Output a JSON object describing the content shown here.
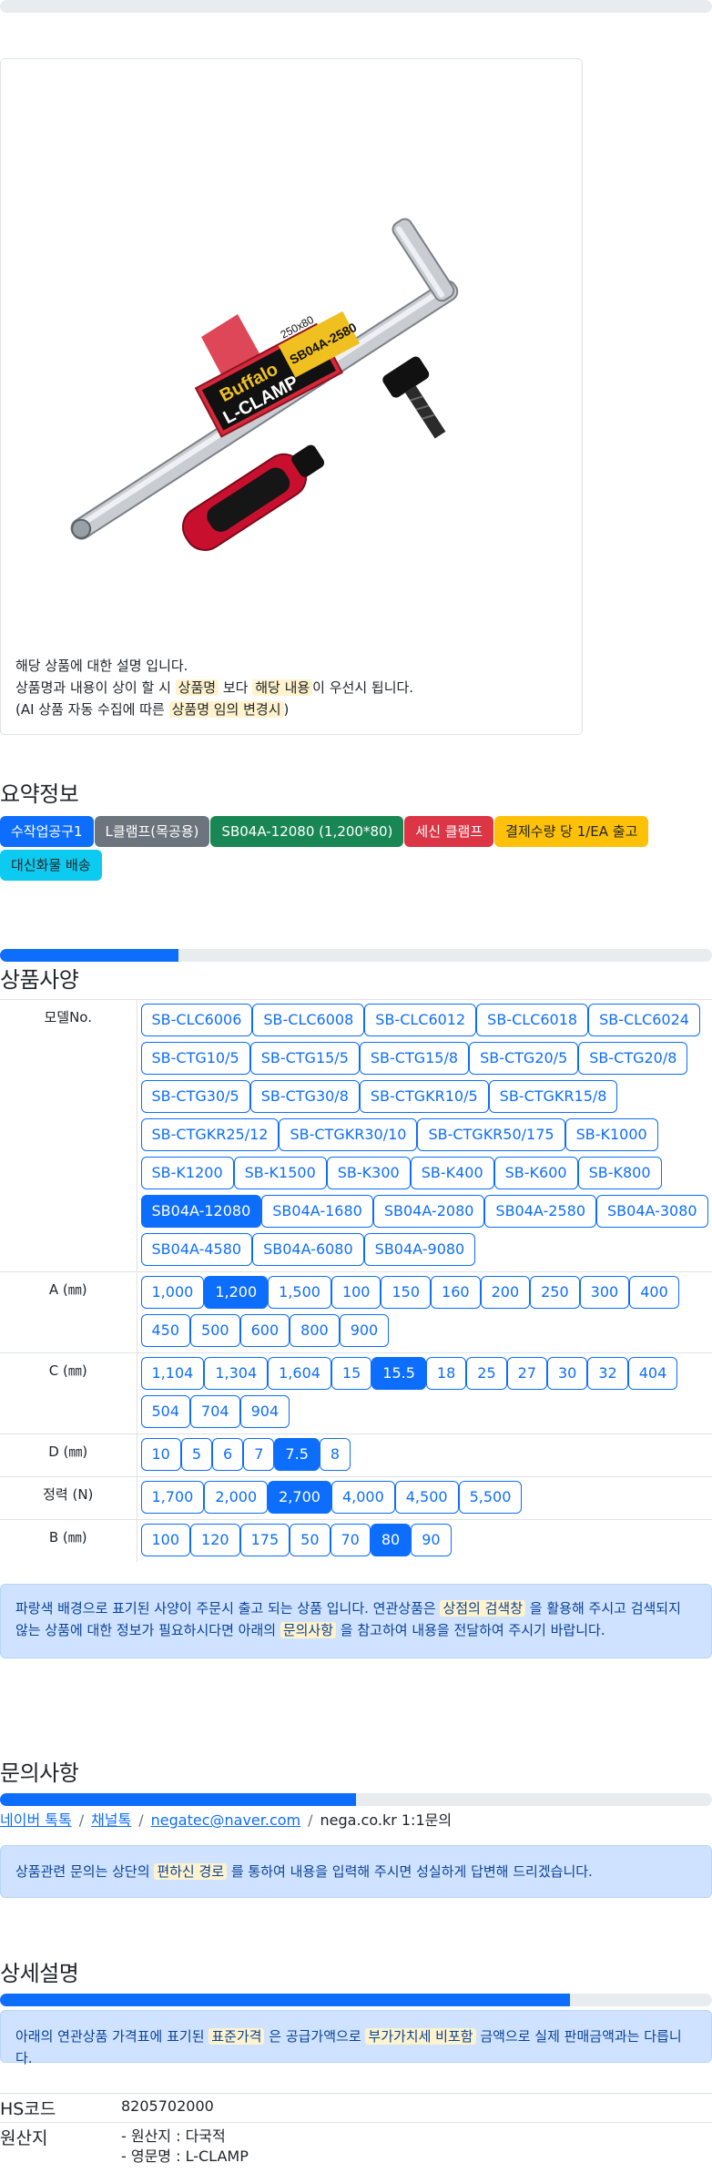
{
  "product_description": {
    "line1": "해당 상품에 대한 설명 입니다.",
    "line2_pre": "상품명과 내용이 상이 할 시 ",
    "line2_hl1": "상품명",
    "line2_mid": " 보다 ",
    "line2_hl2": "해당 내용",
    "line2_post": "이 우선시 됩니다.",
    "line3_pre": "(AI 상품 자동 수집에 따른 ",
    "line3_hl": "상품명 임의 변경시",
    "line3_post": ")"
  },
  "product_image": {
    "brand": "Buffalo",
    "type": "L-CLAMP",
    "model": "SB04A-2580",
    "size": "250x80",
    "icon": "l-clamp-photo"
  },
  "summary": {
    "title": "요약정보",
    "badges": [
      {
        "label": "수작업공구1",
        "color": "#0d6efd",
        "text_color": "#ffffff"
      },
      {
        "label": "L클램프(목공용)",
        "color": "#6c757d",
        "text_color": "#ffffff"
      },
      {
        "label": "SB04A-12080 (1,200*80)",
        "color": "#198754",
        "text_color": "#ffffff"
      },
      {
        "label": "세신 클램프",
        "color": "#dc3545",
        "text_color": "#ffffff"
      },
      {
        "label": "결제수량 당 1/EA 출고",
        "color": "#ffc107",
        "text_color": "#212529"
      },
      {
        "label": "대신화물 배송",
        "color": "#0dcaf0",
        "text_color": "#212529"
      }
    ]
  },
  "spec": {
    "title": "상품사양",
    "progress": 0.25,
    "rows": [
      {
        "label": "모델No.",
        "options": [
          "SB-CLC6006",
          "SB-CLC6008",
          "SB-CLC6012",
          "SB-CLC6018",
          "SB-CLC6024",
          "SB-CTG10/5",
          "SB-CTG15/5",
          "SB-CTG15/8",
          "SB-CTG20/5",
          "SB-CTG20/8",
          "SB-CTG30/5",
          "SB-CTG30/8",
          "SB-CTGKR10/5",
          "SB-CTGKR15/8",
          "SB-CTGKR25/12",
          "SB-CTGKR30/10",
          "SB-CTGKR50/175",
          "SB-K1000",
          "SB-K1200",
          "SB-K1500",
          "SB-K300",
          "SB-K400",
          "SB-K600",
          "SB-K800",
          "SB04A-12080",
          "SB04A-1680",
          "SB04A-2080",
          "SB04A-2580",
          "SB04A-3080",
          "SB04A-4580",
          "SB04A-6080",
          "SB04A-9080"
        ],
        "selected": "SB04A-12080"
      },
      {
        "label": "A (㎜)",
        "options": [
          "1,000",
          "1,200",
          "1,500",
          "100",
          "150",
          "160",
          "200",
          "250",
          "300",
          "400",
          "450",
          "500",
          "600",
          "800",
          "900"
        ],
        "selected": "1,200"
      },
      {
        "label": "C (㎜)",
        "options": [
          "1,104",
          "1,304",
          "1,604",
          "15",
          "15.5",
          "18",
          "25",
          "27",
          "30",
          "32",
          "404",
          "504",
          "704",
          "904"
        ],
        "selected": "15.5"
      },
      {
        "label": "D (㎜)",
        "options": [
          "10",
          "5",
          "6",
          "7",
          "7.5",
          "8"
        ],
        "selected": "7.5"
      },
      {
        "label": "정력 (N)",
        "options": [
          "1,700",
          "2,000",
          "2,700",
          "4,000",
          "4,500",
          "5,500"
        ],
        "selected": "2,700"
      },
      {
        "label": "B (㎜)",
        "options": [
          "100",
          "120",
          "175",
          "50",
          "70",
          "80",
          "90"
        ],
        "selected": "80"
      }
    ],
    "notice_pre": "파랑색 배경으로 표기된 사양이 주문시 출고 되는 상품 입니다. 연관상품은 ",
    "notice_hl1": "상점의 검색창",
    "notice_mid": " 을 활용해 주시고 검색되지 않는 상품에 대한 정보가 필요하시다면 아래의 ",
    "notice_hl2": "문의사항",
    "notice_post": " 을 참고하여 내용을 전달하여 주시기 바랍니다."
  },
  "inquiry": {
    "title": "문의사항",
    "progress": 0.5,
    "links": [
      "네이버 톡톡",
      "채널톡",
      "negatec@naver.com"
    ],
    "plain": "nega.co.kr 1:1문의",
    "notice_pre": "상품관련 문의는 상단의 ",
    "notice_hl": "편하신 경로",
    "notice_post": " 를 통하여 내용을 입력해 주시면 성실하게 답변해 드리겠습니다."
  },
  "detail": {
    "title": "상세설명",
    "progress": 0.8,
    "notice_pre": "아래의 연관상품 가격표에 표기된 ",
    "notice_hl1": "표준가격",
    "notice_mid": " 은 공급가액으로 ",
    "notice_hl2": "부가가치세 비포함",
    "notice_post": " 금액으로 실제 판매금액과는 다릅니다.",
    "hs_label": "HS코드",
    "hs_value": "8205702000",
    "origin_label": "원산지",
    "origin_line1": "- 원산지 : 다국적",
    "origin_line2": "- 영문명 : L-CLAMP"
  }
}
